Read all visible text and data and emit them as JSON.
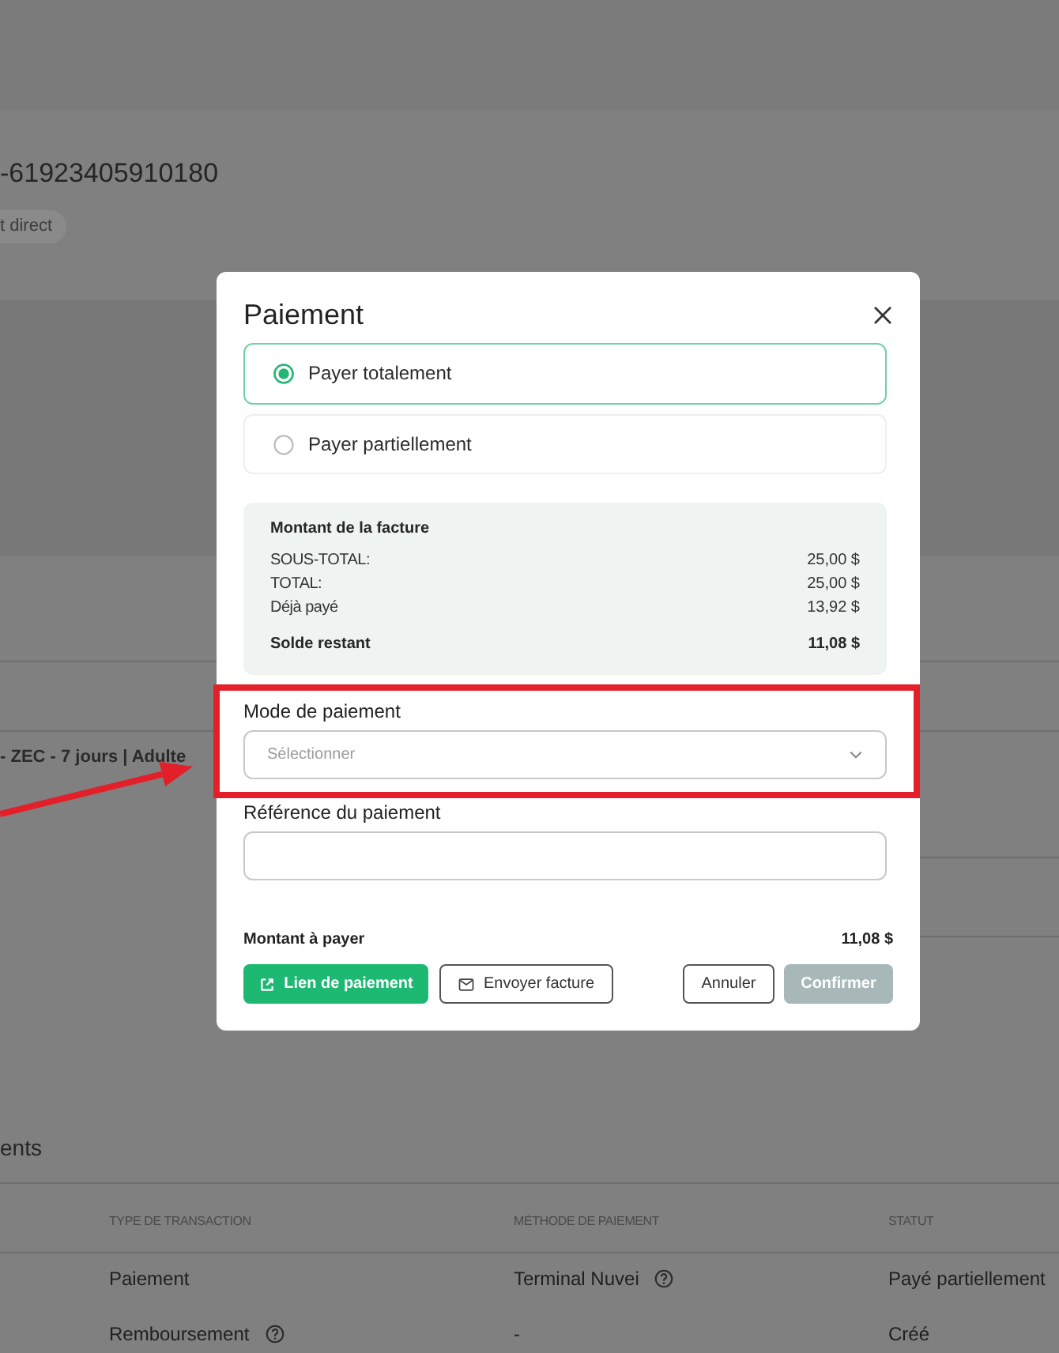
{
  "page": {
    "heading": "-61923405910180",
    "tag": "t direct",
    "line_item": "- ZEC - 7 jours | Adulte",
    "section_title": "ents",
    "table": {
      "columns": [
        "TYPE DE TRANSACTION",
        "MÉTHODE DE PAIEMENT",
        "STATUT"
      ],
      "rows": [
        {
          "cells": [
            {
              "text": "Paiement",
              "help": false
            },
            {
              "text": "Terminal Nuvei",
              "help": true
            },
            {
              "text": "Payé partiellement",
              "help": false
            }
          ]
        },
        {
          "cells": [
            {
              "text": "Remboursement",
              "help": true
            },
            {
              "text": "-",
              "help": false
            },
            {
              "text": "Créé",
              "help": false
            }
          ]
        }
      ]
    }
  },
  "dialog": {
    "title": "Paiement",
    "options": [
      {
        "label": "Payer totalement",
        "selected": true
      },
      {
        "label": "Payer partiellement",
        "selected": false
      }
    ],
    "invoice": {
      "title": "Montant de la facture",
      "rows": [
        {
          "label": "SOUS-TOTAL:",
          "value": "25,00 $"
        },
        {
          "label": "TOTAL:",
          "value": "25,00 $"
        },
        {
          "label": "Déjà payé",
          "value": "13,92 $"
        }
      ],
      "balance": {
        "label": "Solde restant",
        "value": "11,08 $"
      }
    },
    "payment_method": {
      "label": "Mode de paiement",
      "placeholder": "Sélectionner"
    },
    "reference": {
      "label": "Référence du paiement"
    },
    "amount": {
      "label": "Montant à payer",
      "value": "11,08 $"
    },
    "buttons": [
      {
        "label": "Lien de paiement",
        "kind": "link",
        "disabled": false
      },
      {
        "label": "Envoyer facture",
        "kind": "send",
        "disabled": false
      },
      {
        "label": "Annuler",
        "kind": "outline",
        "disabled": false
      },
      {
        "label": "Confirmer",
        "kind": "primary",
        "disabled": true
      }
    ]
  }
}
